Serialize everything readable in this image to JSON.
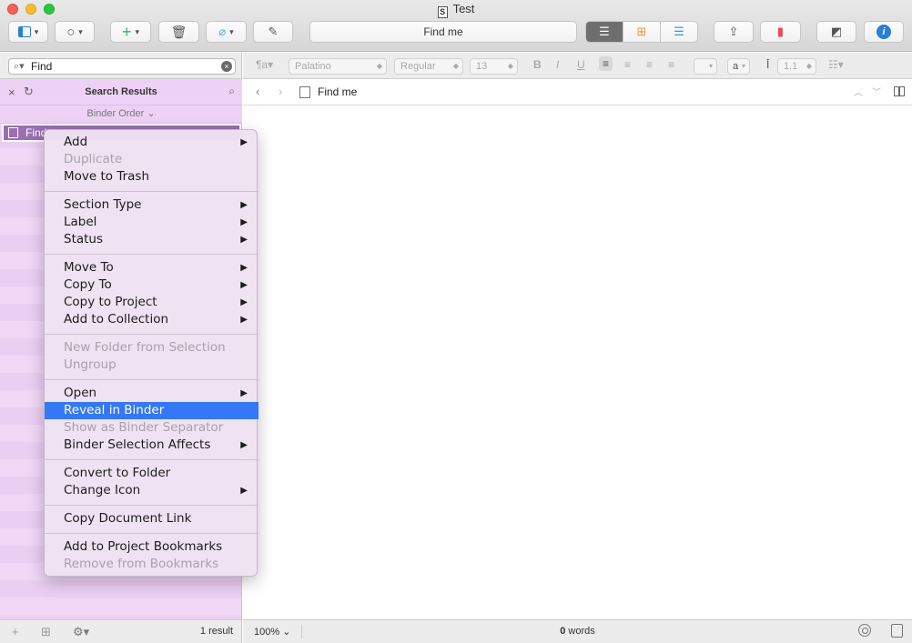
{
  "window": {
    "title": "Test"
  },
  "toolbar": {
    "center_button_label": "Find me"
  },
  "search": {
    "value": "Find"
  },
  "format_bar": {
    "font_family": "Palatino",
    "font_style": "Regular",
    "font_size": "13",
    "bold": "B",
    "italic": "I",
    "underline": "U",
    "line_spacing": "1.1"
  },
  "binder": {
    "title": "Search Results",
    "order_label": "Binder Order",
    "selected_item": "Find",
    "result_count": "1 result"
  },
  "editor": {
    "document_name": "Find me",
    "zoom": "100%",
    "word_count_number": "0",
    "word_count_suffix": "words"
  },
  "context_menu": {
    "add": "Add",
    "duplicate": "Duplicate",
    "move_to_trash": "Move to Trash",
    "section_type": "Section Type",
    "label": "Label",
    "status": "Status",
    "move_to": "Move To",
    "copy_to": "Copy To",
    "copy_to_project": "Copy to Project",
    "add_to_collection": "Add to Collection",
    "new_folder_from_selection": "New Folder from Selection",
    "ungroup": "Ungroup",
    "open": "Open",
    "reveal_in_binder": "Reveal in Binder",
    "show_as_binder_separator": "Show as Binder Separator",
    "binder_selection_affects": "Binder Selection Affects",
    "convert_to_folder": "Convert to Folder",
    "change_icon": "Change Icon",
    "copy_document_link": "Copy Document Link",
    "add_to_project_bookmarks": "Add to Project Bookmarks",
    "remove_from_bookmarks": "Remove from Bookmarks"
  },
  "icons": {
    "close": "window-close-icon",
    "minimize": "window-minimize-icon",
    "zoom": "window-zoom-icon"
  },
  "colors": {
    "binder_bg": "#f0d8f6",
    "selection": "#3478f6",
    "selected_row": "#9a6fb3"
  }
}
